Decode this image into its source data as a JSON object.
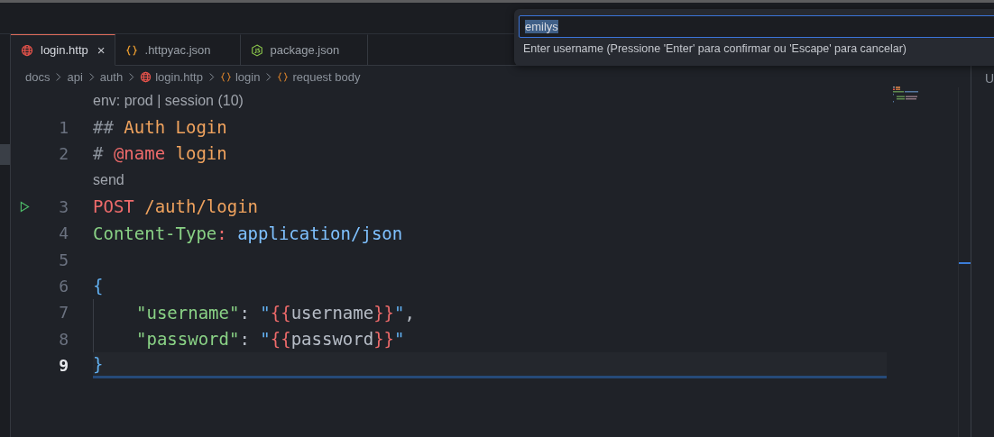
{
  "tabs": [
    {
      "label": "login.http",
      "kind": "http",
      "selected": true,
      "close": "×"
    },
    {
      "label": ".httpyac.json",
      "kind": "json",
      "selected": false
    },
    {
      "label": "package.json",
      "kind": "node",
      "selected": false
    }
  ],
  "breadcrumbs": [
    {
      "label": "docs",
      "kind": "folder"
    },
    {
      "label": "api",
      "kind": "folder"
    },
    {
      "label": "auth",
      "kind": "folder"
    },
    {
      "label": "login.http",
      "kind": "file"
    },
    {
      "label": "login",
      "kind": "symbol"
    },
    {
      "label": "request body",
      "kind": "symbol"
    }
  ],
  "lines": [
    {
      "kind": "lens",
      "text": "env: prod | session (10)"
    },
    {
      "kind": "code",
      "number": "1",
      "run": false,
      "current": false,
      "tokens": [
        {
          "t": "## ",
          "kind": "comment"
        },
        {
          "t": "Auth Login",
          "kind": "heading"
        }
      ]
    },
    {
      "kind": "code",
      "number": "2",
      "run": false,
      "current": false,
      "tokens": [
        {
          "t": "# ",
          "kind": "comment"
        },
        {
          "t": "@name",
          "kind": "keyword"
        },
        {
          "t": " login",
          "kind": "heading"
        }
      ]
    },
    {
      "kind": "lens",
      "text": "send"
    },
    {
      "kind": "code",
      "number": "3",
      "run": true,
      "current": false,
      "tokens": [
        {
          "t": "POST",
          "kind": "keyword"
        },
        {
          "t": " /auth/login",
          "kind": "heading"
        }
      ]
    },
    {
      "kind": "code",
      "number": "4",
      "run": false,
      "current": false,
      "tokens": [
        {
          "t": "Content-Type",
          "kind": "key"
        },
        {
          "t": ": ",
          "kind": "keyword"
        },
        {
          "t": "application/json",
          "kind": "value"
        }
      ]
    },
    {
      "kind": "code",
      "number": "5",
      "run": false,
      "current": false
    },
    {
      "kind": "code",
      "number": "6",
      "run": false,
      "current": false,
      "tokens": [
        {
          "t": "{",
          "kind": "brace"
        }
      ]
    },
    {
      "kind": "code",
      "number": "7",
      "run": false,
      "current": false,
      "indent": true,
      "tokens": [
        {
          "t": "\"username\"",
          "kind": "key"
        },
        {
          "t": ": ",
          "kind": "plain"
        },
        {
          "t": "\"",
          "kind": "brace"
        },
        {
          "t": "{{",
          "kind": "keyword"
        },
        {
          "t": "username",
          "kind": "plain"
        },
        {
          "t": "}}",
          "kind": "keyword"
        },
        {
          "t": "\"",
          "kind": "brace"
        },
        {
          "t": ",",
          "kind": "plain"
        }
      ]
    },
    {
      "kind": "code",
      "number": "8",
      "run": false,
      "current": false,
      "indent": true,
      "tokens": [
        {
          "t": "\"password\"",
          "kind": "key"
        },
        {
          "t": ": ",
          "kind": "plain"
        },
        {
          "t": "\"",
          "kind": "brace"
        },
        {
          "t": "{{",
          "kind": "keyword"
        },
        {
          "t": "password",
          "kind": "plain"
        },
        {
          "t": "}}",
          "kind": "keyword"
        },
        {
          "t": "\"",
          "kind": "brace"
        }
      ]
    },
    {
      "kind": "code",
      "number": "9",
      "run": false,
      "current": true,
      "tokens": [
        {
          "t": "}",
          "kind": "brace"
        }
      ]
    }
  ],
  "quick_input": {
    "value": "emilys",
    "value_selected": true,
    "message": "Enter username (Pressione 'Enter' para confirmar ou 'Escape' para cancelar)"
  },
  "side_panel": {
    "text": "U"
  }
}
